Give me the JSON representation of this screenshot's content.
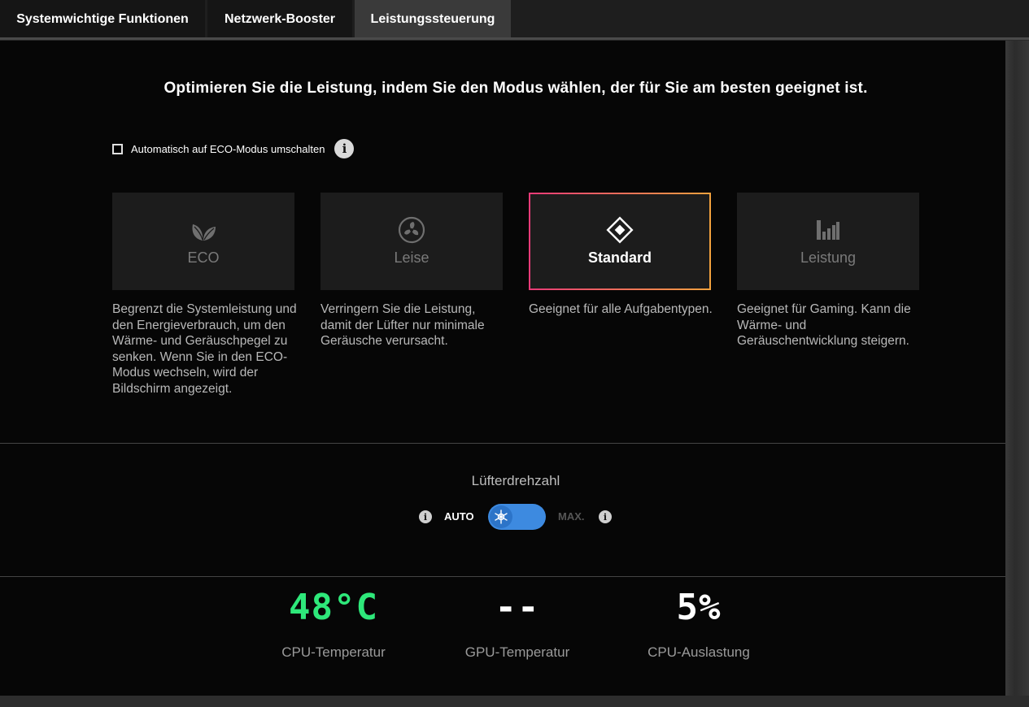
{
  "tabs": [
    {
      "label": "Systemwichtige Funktionen",
      "active": false
    },
    {
      "label": "Netzwerk-Booster",
      "active": false
    },
    {
      "label": "Leistungssteuerung",
      "active": true
    }
  ],
  "headline": "Optimieren Sie die Leistung, indem Sie den Modus wählen, der für Sie am besten geeignet ist.",
  "auto_eco": {
    "label": "Automatisch auf ECO-Modus umschalten",
    "checked": false,
    "info_icon": "info-icon"
  },
  "modes": [
    {
      "label": "ECO",
      "icon": "leaf-icon",
      "selected": false,
      "description": "Begrenzt die Systemleistung und den Energieverbrauch, um den Wärme- und Geräuschpegel zu senken. Wenn Sie in den ECO-Modus wechseln, wird der Bildschirm angezeigt."
    },
    {
      "label": "Leise",
      "icon": "fan-icon",
      "selected": false,
      "description": "Verringern Sie die Leistung, damit der Lüfter nur minimale Geräusche verursacht."
    },
    {
      "label": "Standard",
      "icon": "diamond-icon",
      "selected": true,
      "description": "Geeignet für alle Aufgabentypen."
    },
    {
      "label": "Leistung",
      "icon": "bars-icon",
      "selected": false,
      "description": "Geeignet für Gaming. Kann die Wärme- und Geräuschentwicklung steigern."
    }
  ],
  "fan": {
    "title": "Lüfterdrehzahl",
    "auto_label": "AUTO",
    "max_label": "MAX.",
    "state": "AUTO"
  },
  "stats": [
    {
      "value": "48°C",
      "label": "CPU-Temperatur",
      "color": "#2ee87a"
    },
    {
      "value": "--",
      "label": "GPU-Temperatur",
      "color": "#ffffff"
    },
    {
      "value": "5%",
      "label": "CPU-Auslastung",
      "color": "#ffffff"
    }
  ],
  "colors": {
    "selected_border_start": "#e83a78",
    "selected_border_end": "#f3a23e",
    "toggle": "#3d8ae0"
  }
}
